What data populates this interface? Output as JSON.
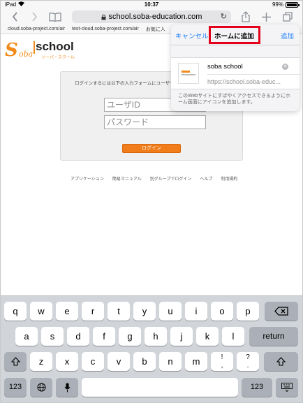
{
  "status_bar": {
    "device": "iPad",
    "time": "10:37",
    "battery": "99%"
  },
  "browser": {
    "url": "school.soba-education.com",
    "bookmarks": [
      "cloud.soba-project.com/air",
      "test-cloud.soba-project.com/air",
      "お気に入"
    ]
  },
  "page": {
    "logo": {
      "s": "S",
      "oba": "oba",
      "school": "school",
      "sub": "ソーバ・スクール"
    },
    "login": {
      "message": "ログインするには以下の入力フォームにユーザーIDとパ",
      "user_id_placeholder": "ユーザID",
      "password_placeholder": "パスワード",
      "login_button": "ログイン"
    },
    "footer_links": [
      "アプリケーション",
      "簡易マニュアル",
      "別グループでログイン",
      "ヘルプ",
      "利用規約"
    ]
  },
  "popover": {
    "cancel": "キャンセル",
    "title": "ホームに追加",
    "add": "追加",
    "name": "soba school",
    "url": "https://school.soba-educ...",
    "note": "このWebサイトにすばやくアクセスできるようにホーム画面にアイコンを追加します。",
    "highlight_color": "#e3001b"
  },
  "keyboard": {
    "row1": [
      "q",
      "w",
      "e",
      "r",
      "t",
      "y",
      "u",
      "i",
      "o",
      "p"
    ],
    "row2": [
      "a",
      "s",
      "d",
      "f",
      "g",
      "h",
      "j",
      "k",
      "l"
    ],
    "row3": [
      "z",
      "x",
      "c",
      "v",
      "b",
      "n",
      "m",
      "!\n,",
      "?\n."
    ],
    "return": "return",
    "numbers": "123",
    "delete_icon": "delete-icon",
    "shift_icon": "shift-icon",
    "globe_icon": "globe-icon",
    "mic_icon": "microphone-icon",
    "keyboard_icon": "keyboard-hide-icon"
  }
}
